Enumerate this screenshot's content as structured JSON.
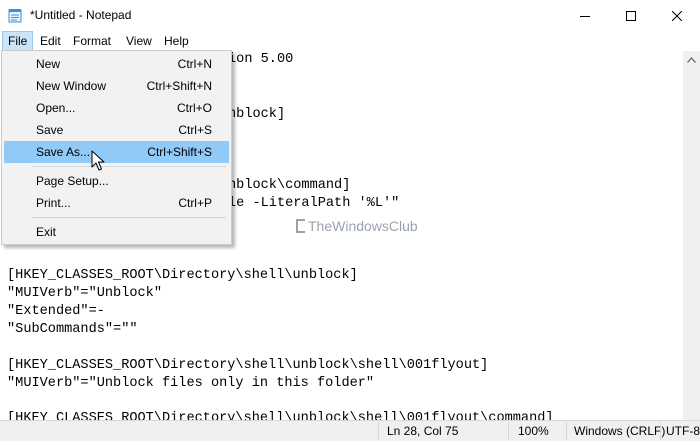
{
  "window": {
    "title": "*Untitled - Notepad"
  },
  "menubar": {
    "items": [
      "File",
      "Edit",
      "Format",
      "View",
      "Help"
    ]
  },
  "file_menu": {
    "items": [
      {
        "label": "New",
        "shortcut": "Ctrl+N"
      },
      {
        "label": "New Window",
        "shortcut": "Ctrl+Shift+N"
      },
      {
        "label": "Open...",
        "shortcut": "Ctrl+O"
      },
      {
        "label": "Save",
        "shortcut": "Ctrl+S"
      },
      {
        "label": "Save As...",
        "shortcut": "Ctrl+Shift+S"
      },
      {
        "label": "Page Setup...",
        "shortcut": ""
      },
      {
        "label": "Print...",
        "shortcut": "Ctrl+P"
      },
      {
        "label": "Exit",
        "shortcut": ""
      }
    ]
  },
  "editor": {
    "lines": [
      "ion 5.00",
      "nblock]",
      "nblock\\command]",
      "le -LiteralPath '%L'\"",
      "[HKEY_CLASSES_ROOT\\Directory\\shell\\unblock]",
      "\"MUIVerb\"=\"Unblock\"",
      "\"Extended\"=-",
      "\"SubCommands\"=\"\"",
      "[HKEY_CLASSES_ROOT\\Directory\\shell\\unblock\\shell\\001flyout]",
      "\"MUIVerb\"=\"Unblock files only in this folder\"",
      "[HKEY_CLASSES_ROOT\\Directory\\shell\\unblock\\shell\\001flyout\\command]"
    ],
    "watermark": "TheWindowsClub"
  },
  "statusbar": {
    "position": "Ln 28, Col 75",
    "zoom": "100%",
    "line_ending": "Windows (CRLF)",
    "encoding": "UTF-8"
  },
  "colors": {
    "menu_highlight": "#91c9f7",
    "menu_active": "#cce4f7",
    "statusbar_bg": "#f0f0f0"
  }
}
